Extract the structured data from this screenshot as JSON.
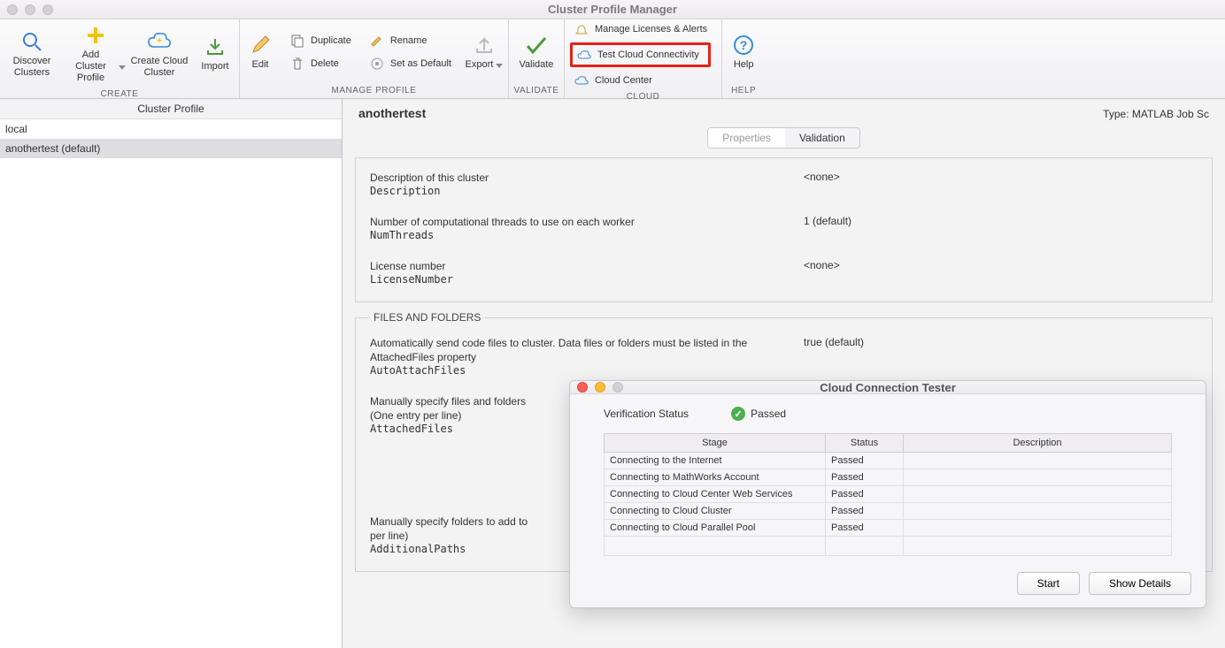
{
  "window": {
    "title": "Cluster Profile Manager"
  },
  "toolstrip": {
    "create": {
      "label": "CREATE",
      "discover": "Discover\nClusters",
      "add": "Add Cluster\nProfile",
      "create_cloud": "Create Cloud\nCluster",
      "import": "Import"
    },
    "manage": {
      "label": "MANAGE PROFILE",
      "edit": "Edit",
      "duplicate": "Duplicate",
      "delete": "Delete",
      "rename": "Rename",
      "set_default": "Set as Default",
      "export": "Export"
    },
    "validate": {
      "label": "VALIDATE",
      "validate": "Validate"
    },
    "cloud": {
      "label": "CLOUD",
      "manage_licenses": "Manage Licenses & Alerts",
      "test_conn": "Test Cloud Connectivity",
      "cloud_center": "Cloud Center"
    },
    "help": {
      "label": "HELP",
      "help": "Help"
    }
  },
  "sidebar": {
    "header": "Cluster Profile",
    "items": [
      "local",
      "anothertest (default)"
    ]
  },
  "content": {
    "title": "anothertest",
    "type": "Type: MATLAB Job Sc",
    "tabs": {
      "properties": "Properties",
      "validation": "Validation"
    },
    "group1": {
      "desc1": "Description of this cluster",
      "key1": "Description",
      "val1": "<none>",
      "desc2": "Number of computational threads to use on each worker",
      "key2": "NumThreads",
      "val2": "1 (default)",
      "desc3": "License number",
      "key3": "LicenseNumber",
      "val3": "<none>"
    },
    "files": {
      "legend": "FILES AND FOLDERS",
      "desc1": "Automatically send code files to cluster. Data files or folders must be listed in the AttachedFiles property",
      "key1": "AutoAttachFiles",
      "val1": "true (default)",
      "desc2": "Manually specify files and folders\n(One entry per line)",
      "key2": "AttachedFiles",
      "desc3": "Manually specify folders to add to\nper line)",
      "key3": "AdditionalPaths"
    }
  },
  "dialog": {
    "title": "Cloud Connection Tester",
    "status_label": "Verification Status",
    "status_value": "Passed",
    "columns": {
      "stage": "Stage",
      "status": "Status",
      "desc": "Description"
    },
    "rows": [
      {
        "stage": "Connecting to the Internet",
        "status": "Passed",
        "desc": ""
      },
      {
        "stage": "Connecting to MathWorks Account",
        "status": "Passed",
        "desc": ""
      },
      {
        "stage": "Connecting to Cloud Center Web Services",
        "status": "Passed",
        "desc": ""
      },
      {
        "stage": "Connecting to Cloud Cluster",
        "status": "Passed",
        "desc": ""
      },
      {
        "stage": "Connecting to Cloud Parallel Pool",
        "status": "Passed",
        "desc": ""
      }
    ],
    "start": "Start",
    "details": "Show Details"
  }
}
